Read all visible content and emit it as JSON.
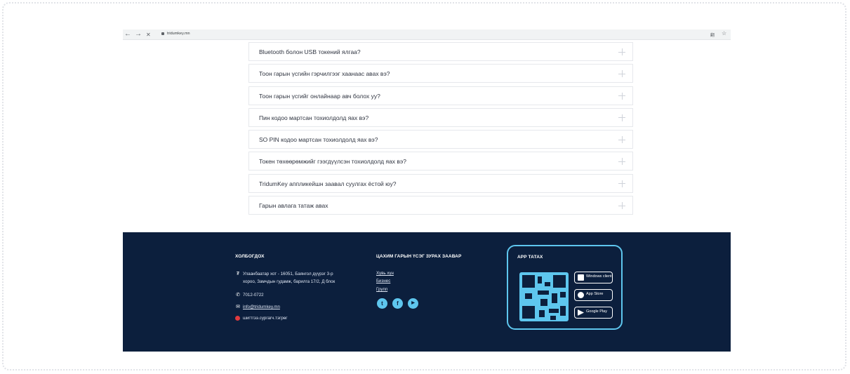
{
  "browser": {
    "back": "←",
    "forward": "→",
    "close": "✕",
    "url": "tridumkey.mn",
    "translate_icon": "翻",
    "bookmark_icon": "☆"
  },
  "faq": [
    "Bluetooth болон USB токений ялгаа?",
    "Тоон гарын үсгийн гэрчилгээг хаанаас авах вэ?",
    "Тоон гарын үсгийг онлайнаар авч болох уу?",
    "Пин кодоо мартсан тохиолдолд яах вэ?",
    "SO PIN кодоо мартсан тохиолдолд яах вэ?",
    "Токен төхөөрөмжийг гээгдүүлсэн тохиолдолд яах вэ?",
    "TridumKey аппликейшн заавал суулгах ёстой юу?",
    "Гарын авлага татаж авах"
  ],
  "footer": {
    "contact": {
      "title": "ХОЛБОГДОХ",
      "address_line1": "Улаанбаатар хот - 16051, Баянгол дүүрэг 3-р",
      "address_line2": "хороо, Замчдын гудамж, барилга 17/2, Д блок",
      "phone": "7012-0722",
      "email": "info@tridumkey.mn",
      "store": "шигтгээ.сургагч.тэгрөг"
    },
    "guide": {
      "title": "ЦАХИМ ГАРЫН ҮСЭГ ЗУРАХ ЗААВАР",
      "links": [
        "Хувь хүн",
        "Бизнес",
        "Групп"
      ]
    },
    "social": {
      "twitter": "t",
      "facebook": "f",
      "youtube": "▶"
    },
    "app": {
      "title": "APP ТАТАХ",
      "windows": "Windows client",
      "appstore": "App Store",
      "googleplay": "Google Play"
    }
  }
}
